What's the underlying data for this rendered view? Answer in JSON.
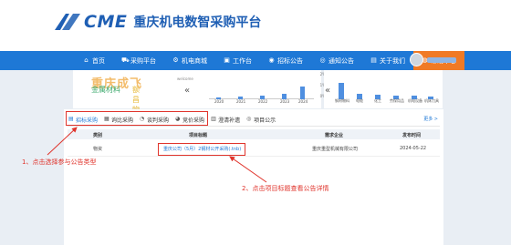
{
  "header": {
    "brand": "CME",
    "title": "重庆机电数智采购平台"
  },
  "nav": {
    "items": [
      {
        "label": "首页",
        "icon": "home-icon",
        "glyph": "⌂"
      },
      {
        "label": "采购平台",
        "icon": "cart-icon",
        "glyph": "⛟"
      },
      {
        "label": "机电商城",
        "icon": "shop-icon",
        "glyph": "⚙"
      },
      {
        "label": "工作台",
        "icon": "desk-icon",
        "glyph": "▣"
      },
      {
        "label": "招标公告",
        "icon": "notice-icon",
        "glyph": "◉"
      },
      {
        "label": "通知公告",
        "icon": "bell-icon",
        "glyph": "◎"
      },
      {
        "label": "关于我们",
        "icon": "info-icon",
        "glyph": "▤"
      },
      {
        "label": "帮助中心",
        "icon": "help-icon",
        "glyph": "◍"
      }
    ],
    "active_index": 7
  },
  "promo": {
    "headline": "重庆成飞",
    "small_text": "welcome",
    "tag_metal": "金属材料",
    "tag_fee": "额昌物料"
  },
  "chart_left": {
    "years": [
      "2020",
      "2021",
      "2022",
      "2023",
      "2024"
    ],
    "y_ticks": [
      "2%",
      "1%",
      "0%"
    ]
  },
  "chart_right": {
    "categories": [
      "钢材物料",
      "电缆",
      "化工",
      "劳保用品",
      "机电设备",
      "机床刀具"
    ]
  },
  "tabs": {
    "items": [
      {
        "label": "招标采购",
        "icon": "bid-icon",
        "glyph": "▤"
      },
      {
        "label": "询比采购",
        "icon": "compare-icon",
        "glyph": "▦"
      },
      {
        "label": "谈判采购",
        "icon": "negotiate-icon",
        "glyph": "◔"
      },
      {
        "label": "竞价采购",
        "icon": "auction-icon",
        "glyph": "◕"
      },
      {
        "label": "澄清补遗",
        "icon": "clarify-icon",
        "glyph": "▥"
      },
      {
        "label": "项目公示",
        "icon": "publicity-icon",
        "glyph": "◎"
      }
    ],
    "more": "更多 >"
  },
  "table": {
    "headers": [
      "类别",
      "项目标题",
      "需求企业",
      "发布时间"
    ],
    "rows": [
      {
        "category": "物资",
        "title": "重庆公司（5月）2钢材公开采购(.tnb)",
        "company": "重庆重型机械有限公司",
        "date": "2024-05-22"
      }
    ]
  },
  "annotations": {
    "step1": "1、点击选择参与公告类型",
    "step2": "2、点击项目标题查看公告详情"
  },
  "colors": {
    "primary": "#1e78d6",
    "accent": "#f07a25",
    "annotation": "#e0342c"
  }
}
